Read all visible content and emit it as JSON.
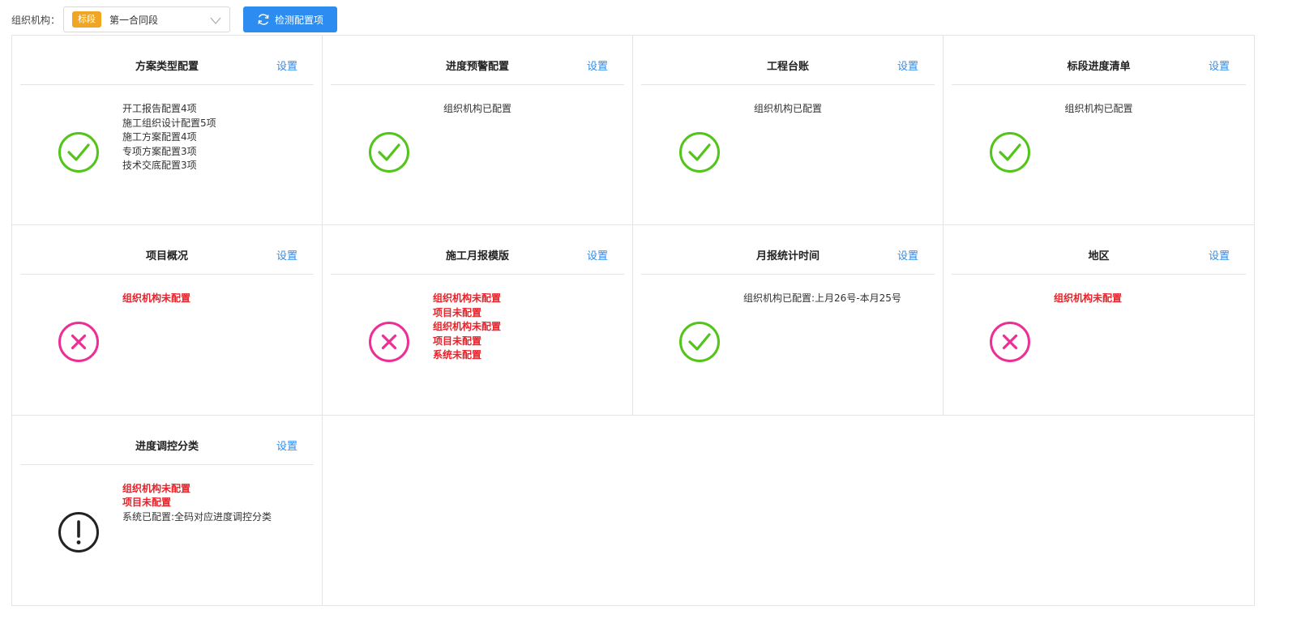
{
  "toolbar": {
    "org_label": "组织机构：",
    "tag": "标段",
    "org_value": "第一合同段",
    "check_button": "检测配置项"
  },
  "colors": {
    "ok": "#52c41a",
    "error": "#eb2f96",
    "warn": "#222222",
    "primary": "#2d8cf0",
    "tag": "#f0a623"
  },
  "cards": [
    {
      "title": "方案类型配置",
      "link": "设置",
      "status": "ok",
      "align": "left",
      "lines": [
        {
          "text": "开工报告配置4项",
          "error": false
        },
        {
          "text": "施工组织设计配置5项",
          "error": false
        },
        {
          "text": "施工方案配置4项",
          "error": false
        },
        {
          "text": "专项方案配置3项",
          "error": false
        },
        {
          "text": "技术交底配置3项",
          "error": false
        }
      ]
    },
    {
      "title": "进度预警配置",
      "link": "设置",
      "status": "ok",
      "align": "center",
      "lines": [
        {
          "text": "组织机构已配置",
          "error": false
        }
      ]
    },
    {
      "title": "工程台账",
      "link": "设置",
      "status": "ok",
      "align": "center",
      "lines": [
        {
          "text": "组织机构已配置",
          "error": false
        }
      ]
    },
    {
      "title": "标段进度清单",
      "link": "设置",
      "status": "ok",
      "align": "center",
      "lines": [
        {
          "text": "组织机构已配置",
          "error": false
        }
      ]
    },
    {
      "title": "项目概况",
      "link": "设置",
      "status": "error",
      "align": "left",
      "lines": [
        {
          "text": "组织机构未配置",
          "error": true
        }
      ]
    },
    {
      "title": "施工月报模版",
      "link": "设置",
      "status": "error",
      "align": "left",
      "lines": [
        {
          "text": "组织机构未配置",
          "error": true
        },
        {
          "text": "项目未配置",
          "error": true
        },
        {
          "text": "组织机构未配置",
          "error": true
        },
        {
          "text": "项目未配置",
          "error": true
        },
        {
          "text": "系统未配置",
          "error": true
        }
      ]
    },
    {
      "title": "月报统计时间",
      "link": "设置",
      "status": "ok",
      "align": "left",
      "lines": [
        {
          "text": "组织机构已配置:上月26号-本月25号",
          "error": false
        }
      ]
    },
    {
      "title": "地区",
      "link": "设置",
      "status": "error",
      "align": "left",
      "lines": [
        {
          "text": "组织机构未配置",
          "error": true
        }
      ]
    },
    {
      "title": "进度调控分类",
      "link": "设置",
      "status": "warn",
      "align": "left",
      "lines": [
        {
          "text": "组织机构未配置",
          "error": true
        },
        {
          "text": "项目未配置",
          "error": true
        },
        {
          "text": "系统已配置:全码对应进度调控分类",
          "error": false
        }
      ]
    }
  ]
}
